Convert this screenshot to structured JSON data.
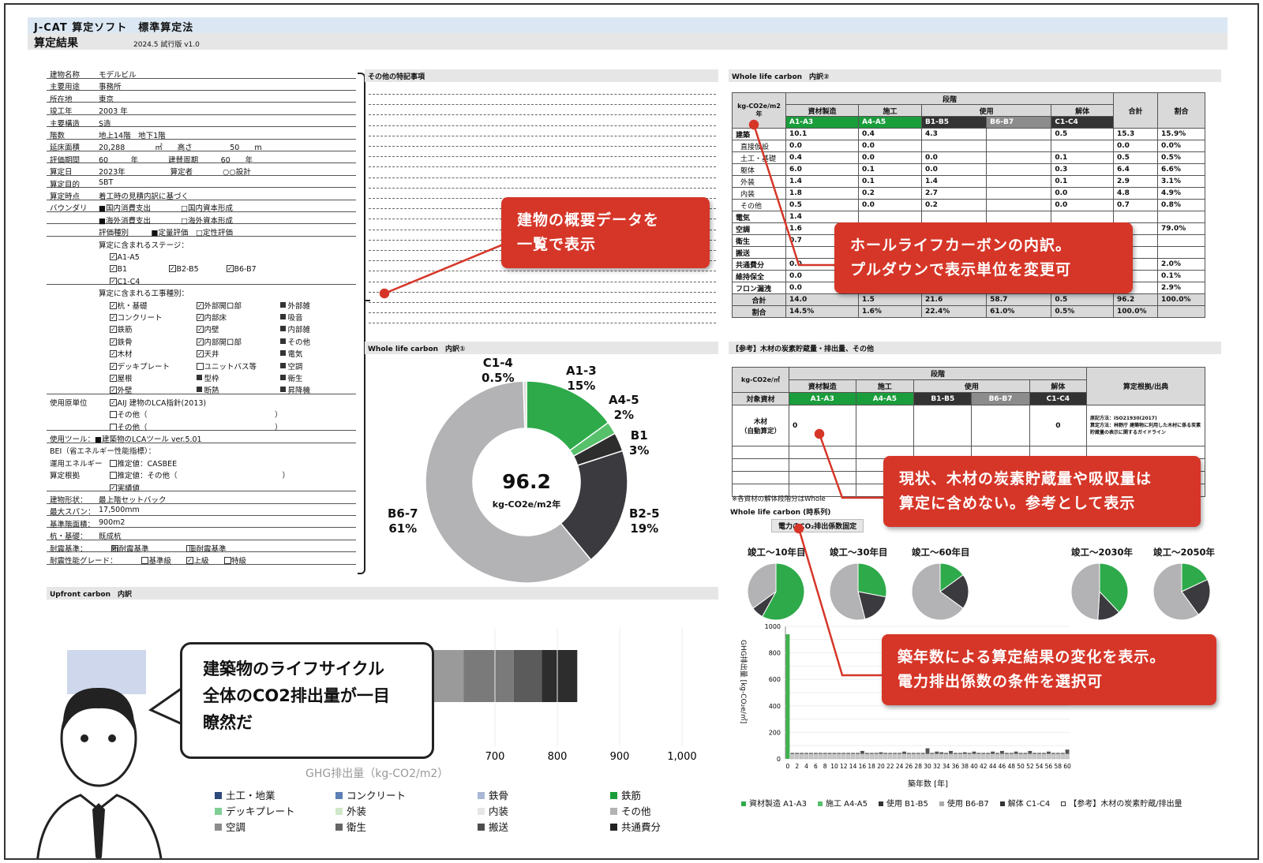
{
  "header": {
    "app_title": "J-CAT 算定ソフト　標準算定法",
    "page_title": "算定結果",
    "version": "2024.5  試行版  v1.0"
  },
  "info": {
    "rows": [
      [
        "建物名称",
        "モデルビル"
      ],
      [
        "主要用途",
        "事務所"
      ],
      [
        "所在地",
        "東京"
      ],
      [
        "竣工年",
        "2003 年"
      ],
      [
        "主要構造",
        "S造"
      ],
      [
        "階数",
        "地上14階　地下1階"
      ],
      [
        "延床面積",
        "20,288　　　　㎡　　高さ　　　　　50　　m"
      ],
      [
        "評価期間",
        "60　　　年　　　　建替周期　　　60　　年"
      ],
      [
        "算定日",
        "2023年　　　　　　算定者　　　　○○設計"
      ],
      [
        "算定目的",
        "SBT"
      ],
      [
        "算定時点",
        "着工時の見積内訳に基づく"
      ]
    ],
    "boundary_label": "バウンダリ",
    "boundary": [
      "■国内消費支出　　　　□国内資本形成",
      "■海外消費支出　　　　□海外資本形成",
      "評価種別　　　■定量評価　□定性評価"
    ],
    "stages_label": "算定に含まれるステージ：",
    "stages": [
      "A1-A5",
      "B1",
      "B2-B5",
      "B6-B7",
      "C1-C4"
    ],
    "works_label": "算定に含まれる工事種別：",
    "works": [
      [
        "杭・基礎",
        "外部開口部",
        "外部雑"
      ],
      [
        "コンクリート",
        "内部床",
        "吸音"
      ],
      [
        "鉄筋",
        "内壁",
        "内部雑"
      ],
      [
        "鉄骨",
        "内部開口部",
        "その他"
      ],
      [
        "木材",
        "天井",
        "電気"
      ],
      [
        "デッキプレート",
        "ユニットバス等",
        "空調"
      ],
      [
        "屋根",
        "型枠",
        "衛生"
      ],
      [
        "外壁",
        "断熱",
        "昇降機"
      ]
    ],
    "unit_label": "使用原単位",
    "units": [
      "AIJ 建物のLCA指針(2013)",
      "その他（",
      "その他（"
    ],
    "tool": "使用ツール：■建築物のLCAツール ver.5.01",
    "bei": "BEI（省エネルギー性能指標）：",
    "energy_label": "運用エネルギー",
    "energy": [
      "推定値：CASBEE",
      "推定値：その他（",
      "実績値"
    ],
    "calc_basis": "算定根拠",
    "tail": [
      [
        "建物形状：",
        "最上階セットバック"
      ],
      [
        "最大スパン：",
        "17,500mm"
      ],
      [
        "基準階面積：",
        "900m2"
      ],
      [
        "杭・基礎：",
        "既成杭"
      ],
      [
        "耐震基準：",
        "新耐震基準　　　　　旧耐震基準"
      ],
      [
        "耐震性能グレード：",
        "基準級　　　　上級　　　　特級"
      ]
    ]
  },
  "sections": {
    "other": "その他の特記事項",
    "wlc1": "Whole life carbon　内訳①",
    "wlc2": "Whole life carbon　内訳②",
    "upfront": "Upfront carbon　内訳",
    "ref": "【参考】木材の炭素貯蔵量・排出量、その他",
    "timeseries": "Whole life carbon (時系列)",
    "co2note": "電力のCO₂排出係数固定",
    "note_small": "※各資材の解体段階分はWhole"
  },
  "table1": {
    "unit": "kg-CO2e/m2年",
    "stage_head": "段階",
    "cols": [
      "資材製造",
      "施工",
      "使用",
      "解体"
    ],
    "codes": [
      "A1-A3",
      "A4-A5",
      "B1-B5",
      "B6-B7",
      "C1-C4"
    ],
    "total": "合計",
    "ratio": "割合",
    "rows": [
      [
        "建築",
        "10.1",
        "0.4",
        "4.3",
        "",
        "0.5",
        "15.3",
        "15.9%"
      ],
      [
        "直接仮設",
        "0.0",
        "0.0",
        "",
        "",
        "",
        "0.0",
        "0.0%"
      ],
      [
        "土工・基礎",
        "0.4",
        "0.0",
        "0.0",
        "",
        "0.1",
        "0.5",
        "0.5%"
      ],
      [
        "躯体",
        "6.0",
        "0.1",
        "0.0",
        "",
        "0.3",
        "6.4",
        "6.6%"
      ],
      [
        "外装",
        "1.4",
        "0.1",
        "1.4",
        "",
        "0.1",
        "2.9",
        "3.1%"
      ],
      [
        "内装",
        "1.8",
        "0.2",
        "2.7",
        "",
        "0.0",
        "4.8",
        "4.9%"
      ],
      [
        "その他",
        "0.5",
        "0.0",
        "0.2",
        "",
        "0.0",
        "0.7",
        "0.8%"
      ],
      [
        "電気",
        "1.4",
        "",
        "",
        "",
        "",
        "",
        ""
      ],
      [
        "空調",
        "1.6",
        "",
        "",
        "",
        "",
        "",
        "79.0%"
      ],
      [
        "衛生",
        "0.7",
        "",
        "",
        "",
        "",
        "",
        ""
      ],
      [
        "搬送",
        "",
        "",
        "",
        "",
        "",
        "",
        ""
      ],
      [
        "共通費分",
        "0.0",
        "",
        "",
        "",
        "",
        "",
        "2.0%"
      ],
      [
        "維持保全",
        "0.0",
        "",
        "",
        "",
        "",
        "",
        "0.1%"
      ],
      [
        "フロン漏洩",
        "0.0",
        "",
        "",
        "",
        "",
        "",
        "2.9%"
      ],
      [
        "合計",
        "14.0",
        "1.5",
        "21.6",
        "58.7",
        "0.5",
        "96.2",
        "100.0%"
      ],
      [
        "割合",
        "14.5%",
        "1.6%",
        "22.4%",
        "61.0%",
        "0.5%",
        "100.0%",
        ""
      ]
    ]
  },
  "table2": {
    "unit": "kg-CO2e/㎡",
    "stage_head": "段階",
    "cols": [
      "資材製造",
      "施工",
      "使用",
      "解体"
    ],
    "target": "対象資材",
    "codes": [
      "A1-A3",
      "A4-A5",
      "B1-B5",
      "B6-B7",
      "C1-C4"
    ],
    "basis": "算定根拠/出典",
    "wood": "木材\n（自動算定）",
    "wood_a": "0",
    "wood_c": "0",
    "basis_text1": "原記方法：ISO21930(2017)",
    "basis_text2": "算定方法：林野庁 建築物に利用した木材に係る炭素貯蔵量の表示に関するガイドライン"
  },
  "donut": {
    "center_value": "96.2",
    "center_unit": "kg-CO2e/m2年",
    "labels": [
      {
        "code": "C1-4",
        "pct": "0.5%"
      },
      {
        "code": "A1-3",
        "pct": "15%"
      },
      {
        "code": "A4-5",
        "pct": "2%"
      },
      {
        "code": "B1",
        "pct": "3%"
      },
      {
        "code": "B2-5",
        "pct": "19%"
      },
      {
        "code": "B6-7",
        "pct": "61%"
      }
    ]
  },
  "chart_data": [
    {
      "type": "pie",
      "title": "",
      "segments": [
        {
          "label": "A1-3",
          "value": 15,
          "color": "#2eaa4a"
        },
        {
          "label": "A4-5",
          "value": 2,
          "color": "#56c06a"
        },
        {
          "label": "B1",
          "value": 3,
          "color": "#2d2d2d"
        },
        {
          "label": "B2-5",
          "value": 19,
          "color": "#3a3a3f"
        },
        {
          "label": "B6-7",
          "value": 60.5,
          "color": "#b3b3b5"
        },
        {
          "label": "C1-4",
          "value": 0.5,
          "color": "#d9d9d9"
        }
      ],
      "center_value": 96.2,
      "center_unit": "kg-CO2e/m2年"
    },
    {
      "type": "bar",
      "orientation": "horizontal",
      "stacked": true,
      "xlabel": "GHG排出量（kg-CO2/m2）",
      "xticks": [
        "700",
        "800",
        "900",
        "1,000"
      ],
      "ticks_visible": [
        700,
        800,
        900,
        1000
      ],
      "segments_visible": [
        {
          "from": 540,
          "to": 650,
          "color": "#9a9a9a"
        },
        {
          "from": 650,
          "to": 730,
          "color": "#7a7a7a"
        },
        {
          "from": 730,
          "to": 775,
          "color": "#5b5b5b"
        },
        {
          "from": 775,
          "to": 832,
          "color": "#2d2d2d"
        }
      ],
      "series": [
        {
          "name": "土工・地業",
          "color": "#2d4a7a"
        },
        {
          "name": "コンクリート",
          "color": "#5d7fb5"
        },
        {
          "name": "鉄骨",
          "color": "#a8b7d6"
        },
        {
          "name": "鉄筋",
          "color": "#1a9d3b"
        },
        {
          "name": "デッキプレート",
          "color": "#7fcf95"
        },
        {
          "name": "外装",
          "color": "#cfe8c9"
        },
        {
          "name": "内装",
          "color": "#e6e6e6"
        },
        {
          "name": "その他",
          "color": "#b3b3b3"
        },
        {
          "name": "空調",
          "color": "#8c8c8c"
        },
        {
          "name": "衛生",
          "color": "#666666"
        },
        {
          "name": "搬送",
          "color": "#4d4d4d"
        },
        {
          "name": "共通費分",
          "color": "#222222"
        }
      ]
    },
    {
      "type": "pie",
      "title": "竣工～10年目",
      "segments": [
        {
          "label": "green",
          "value": 58,
          "color": "#2eaa4a"
        },
        {
          "label": "dark",
          "value": 7,
          "color": "#3a3a3f"
        },
        {
          "label": "gray",
          "value": 35,
          "color": "#b3b3b5"
        }
      ]
    },
    {
      "type": "pie",
      "title": "竣工～30年目",
      "segments": [
        {
          "label": "green",
          "value": 28,
          "color": "#2eaa4a"
        },
        {
          "label": "dark",
          "value": 18,
          "color": "#3a3a3f"
        },
        {
          "label": "gray",
          "value": 54,
          "color": "#b3b3b5"
        }
      ]
    },
    {
      "type": "pie",
      "title": "竣工～60年目",
      "segments": [
        {
          "label": "green",
          "value": 15,
          "color": "#2eaa4a"
        },
        {
          "label": "dark",
          "value": 20,
          "color": "#3a3a3f"
        },
        {
          "label": "gray",
          "value": 65,
          "color": "#b3b3b5"
        }
      ]
    },
    {
      "type": "pie",
      "title": "竣工～2030年",
      "segments": [
        {
          "label": "green",
          "value": 38,
          "color": "#2eaa4a"
        },
        {
          "label": "dark",
          "value": 13,
          "color": "#3a3a3f"
        },
        {
          "label": "gray",
          "value": 49,
          "color": "#b3b3b5"
        }
      ]
    },
    {
      "type": "pie",
      "title": "竣工～2050年",
      "segments": [
        {
          "label": "green",
          "value": 18,
          "color": "#2eaa4a"
        },
        {
          "label": "dark",
          "value": 22,
          "color": "#3a3a3f"
        },
        {
          "label": "gray",
          "value": 60,
          "color": "#b3b3b5"
        }
      ]
    },
    {
      "type": "bar",
      "title": "",
      "ylabel": "GHG排出量 [kg-CO₂e/㎡]",
      "xlabel": "築年数 [年]",
      "ylim": [
        0,
        1000
      ],
      "yticks": [
        0,
        100,
        200,
        300,
        400,
        500,
        600,
        700,
        800,
        900,
        1000
      ],
      "xticks": [
        0,
        2,
        4,
        6,
        8,
        10,
        12,
        14,
        16,
        18,
        20,
        22,
        24,
        26,
        28,
        30,
        32,
        34,
        36,
        38,
        40,
        42,
        44,
        46,
        48,
        50,
        52,
        54,
        56,
        58,
        60
      ],
      "x": [
        0,
        1,
        2,
        3,
        4,
        5,
        6,
        7,
        8,
        9,
        10,
        11,
        12,
        13,
        14,
        15,
        16,
        17,
        18,
        19,
        20,
        21,
        22,
        23,
        24,
        25,
        26,
        27,
        28,
        29,
        30,
        31,
        32,
        33,
        34,
        35,
        36,
        37,
        38,
        39,
        40,
        41,
        42,
        43,
        44,
        45,
        46,
        47,
        48,
        49,
        50,
        51,
        52,
        53,
        54,
        55,
        56,
        57,
        58,
        59,
        60
      ],
      "values": [
        940,
        45,
        45,
        45,
        45,
        45,
        45,
        45,
        45,
        45,
        45,
        45,
        45,
        45,
        45,
        45,
        60,
        45,
        45,
        45,
        50,
        45,
        45,
        45,
        45,
        55,
        45,
        45,
        45,
        45,
        80,
        45,
        55,
        50,
        45,
        60,
        45,
        45,
        50,
        45,
        55,
        45,
        45,
        45,
        55,
        45,
        60,
        45,
        45,
        55,
        45,
        45,
        60,
        45,
        45,
        45,
        55,
        45,
        45,
        45,
        70
      ],
      "legend": [
        "資材製造 A1-A3",
        "施工 A4-A5",
        "使用 B1-B5",
        "使用 B6-B7",
        "解体 C1-C4",
        "【参考】木材の炭素貯蔵/排出量"
      ]
    }
  ],
  "callouts": {
    "c1": "建物の概要データを\n一覧で表示",
    "c2": "ホールライフカーボンの内訳。\nプルダウンで表示単位を変更可",
    "c3": "現状、木材の炭素貯蔵量や吸収量は\n算定に含めない。参考として表示",
    "c4": "築年数による算定結果の変化を表示。\n電力排出係数の条件を選択可"
  },
  "speech": "建築物のライフサイクル\n全体のCO2排出量が一目\n瞭然だ",
  "colors": {
    "callout": "#d63628",
    "green": "#1a9d3b"
  }
}
